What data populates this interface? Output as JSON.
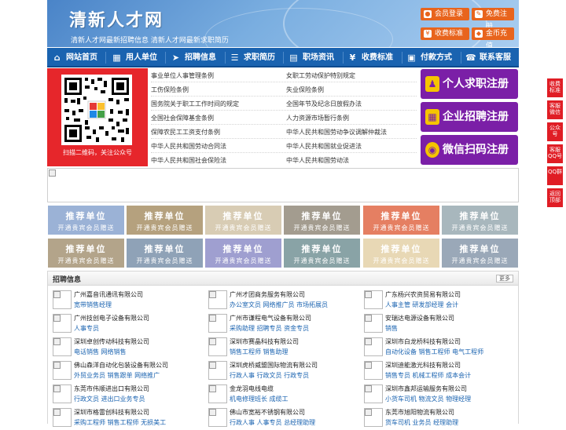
{
  "header": {
    "title": "清新人才网",
    "subtitle": "清新人才网最新招聘信息   清新人才网最新求职简历",
    "buttons": [
      {
        "label": "会员登录",
        "icon": "user-icon"
      },
      {
        "label": "免费注册",
        "icon": "register-icon"
      },
      {
        "label": "收费标准",
        "icon": "yen-icon"
      },
      {
        "label": "金币充值",
        "icon": "coin-icon"
      }
    ]
  },
  "nav": [
    {
      "label": "网站首页",
      "icon": "home-icon"
    },
    {
      "label": "用人单位",
      "icon": "building-icon"
    },
    {
      "label": "招聘信息",
      "icon": "megaphone-icon"
    },
    {
      "label": "求职简历",
      "icon": "resume-icon"
    },
    {
      "label": "职场资讯",
      "icon": "news-icon"
    },
    {
      "label": "收费标准",
      "icon": "yen-icon"
    },
    {
      "label": "付款方式",
      "icon": "payment-icon"
    },
    {
      "label": "联系客服",
      "icon": "phone-icon"
    }
  ],
  "qr": {
    "caption": "扫描二维码，关注公众号"
  },
  "regulations": {
    "left": [
      "事业单位人事管理条例",
      "工伤保险条例",
      "国务院关于职工工作时间的规定",
      "全国社会保障基金条例",
      "保障农民工工资支付条例",
      "中华人民共和国劳动合同法",
      "中华人民共和国社会保险法"
    ],
    "right": [
      "女职工劳动保护特别规定",
      "失业保险条例",
      "全国年节及纪念日放假办法",
      "人力资源市场暂行条例",
      "中华人民共和国劳动争议调解仲裁法",
      "中华人民共和国就业促进法",
      "中华人民共和国劳动法"
    ]
  },
  "register": [
    {
      "label": "个人求职注册",
      "icon": "person-icon"
    },
    {
      "label": "企业招聘注册",
      "icon": "company-icon"
    },
    {
      "label": "微信扫码注册",
      "icon": "wechat-icon"
    }
  ],
  "recommend": {
    "title": "推荐单位",
    "subtitle": "开通贵宾会员赠送",
    "colors": [
      "#9bb2d6",
      "#b5a17e",
      "#d8ccb4",
      "#a39c8f",
      "#e57f62",
      "#a8b7bd",
      "#b3a48a",
      "#8fa2b7",
      "#9f9fd0",
      "#89a3a6",
      "#e8d8b5",
      "#9aa8b8"
    ]
  },
  "jobs": {
    "title": "招聘信息",
    "more": "更多",
    "items": [
      {
        "company": "广州嘉音讯通讯有限公司",
        "positions": "宽带销售经理"
      },
      {
        "company": "广州才团商务服务有限公司",
        "positions": "办公室文员 网络推广员 市场拓展员"
      },
      {
        "company": "广东杨兴农资贸易有限公司",
        "positions": "人事主管 研发部经理 会计"
      },
      {
        "company": "广州技创电子设备有限公司",
        "positions": "人事专员"
      },
      {
        "company": "广州市谦程电气设备有限公司",
        "positions": "采购助理 招聘专员 资金专员"
      },
      {
        "company": "安瑞达电源设备有限公司",
        "positions": "销售"
      },
      {
        "company": "深圳卓创传动科技有限公司",
        "positions": "电话销售 网络销售"
      },
      {
        "company": "深圳市赛晶科技有限公司",
        "positions": "销售工程师 销售助理"
      },
      {
        "company": "深圳市白龙桥科技有限公司",
        "positions": "自动化设备 销售工程师 电气工程师"
      },
      {
        "company": "佛山森洋自动化包装设备有限公司",
        "positions": "外贸业务员 销售跟单 网络推广"
      },
      {
        "company": "深圳虎桥威盟国际物流有限公司",
        "positions": "行政人事 行政文员 行政专员"
      },
      {
        "company": "深圳迪能激光科技有限公司",
        "positions": "销售专员 机械工程师 成本会计"
      },
      {
        "company": "东莞市伟顺进出口有限公司",
        "positions": "行政文员 进出口业务专员"
      },
      {
        "company": "金龙羽电线电缆",
        "positions": "机电修理班长 成缆工"
      },
      {
        "company": "深圳市鑫邦运输服务有限公司",
        "positions": "小货车司机 物流文员 物理经理"
      },
      {
        "company": "深圳市格雷创科技有限公司",
        "positions": "采购工程师 销售工程师 无损美工"
      },
      {
        "company": "佛山市宽裕不锈钢有限公司",
        "positions": "行政人事 人事专员 总经理助理"
      },
      {
        "company": "东莞市旭阳物流有限公司",
        "positions": "货车司机 业务员 经理助理"
      }
    ]
  },
  "float_bar": [
    {
      "label": "收费标准"
    },
    {
      "label": "客服微信"
    },
    {
      "label": "公众号"
    },
    {
      "label": "客服QQ号"
    },
    {
      "label": "QQ群"
    },
    {
      "label": "返回顶部"
    }
  ]
}
